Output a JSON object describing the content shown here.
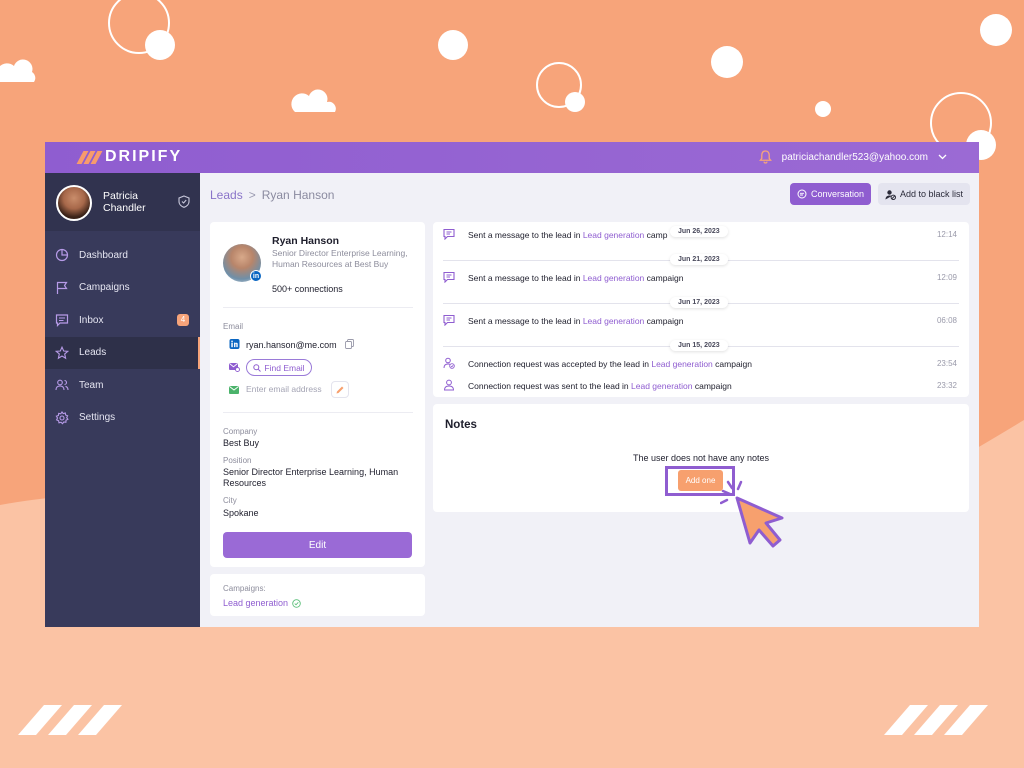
{
  "brand": {
    "name": "DRIPIFY"
  },
  "topbar": {
    "user_email": "patriciachandler523@yahoo.com"
  },
  "user": {
    "name": "Patricia Chandler"
  },
  "nav": [
    {
      "label": "Dashboard",
      "icon": "pie-chart-icon"
    },
    {
      "label": "Campaigns",
      "icon": "flag-icon"
    },
    {
      "label": "Inbox",
      "icon": "message-icon",
      "badge": "4"
    },
    {
      "label": "Leads",
      "icon": "star-icon",
      "active": true
    },
    {
      "label": "Team",
      "icon": "users-icon"
    },
    {
      "label": "Settings",
      "icon": "gear-icon"
    }
  ],
  "breadcrumb": {
    "root": "Leads",
    "separator": ">",
    "current": "Ryan Hanson"
  },
  "actions": {
    "conversation": "Conversation",
    "blacklist": "Add to black list"
  },
  "lead": {
    "name": "Ryan Hanson",
    "headline": "Senior Director Enterprise Learning, Human Resources at Best Buy",
    "connections": "500+ connections",
    "email_label": "Email",
    "email": "ryan.hanson@me.com",
    "find_email": "Find Email",
    "email_placeholder": "Enter email address",
    "company_label": "Company",
    "company": "Best Buy",
    "position_label": "Position",
    "position": "Senior Director Enterprise Learning, Human Resources",
    "city_label": "City",
    "city": "Spokane",
    "edit": "Edit"
  },
  "campaigns": {
    "label": "Campaigns:",
    "name": "Lead generation"
  },
  "activity": [
    {
      "prefix": "Sent a message to the lead in ",
      "link": "Lead generation",
      "suffix": " camp",
      "time": "12:14",
      "icon": "message-icon"
    },
    {
      "prefix": "Sent a message to the lead in ",
      "link": "Lead generation",
      "suffix": " campaign",
      "time": "12:09",
      "icon": "message-icon"
    },
    {
      "prefix": "Sent a message to the lead in ",
      "link": "Lead generation",
      "suffix": " campaign",
      "time": "06:08",
      "icon": "message-icon"
    },
    {
      "prefix": "Connection request was accepted by the lead in ",
      "link": "Lead generation",
      "suffix": " campaign",
      "time": "23:54",
      "icon": "user-check-icon"
    },
    {
      "prefix": "Connection request was sent to the lead in ",
      "link": "Lead generation",
      "suffix": " campaign",
      "time": "23:32",
      "icon": "user-icon"
    }
  ],
  "dates": [
    "Jun 26, 2023",
    "Jun 21, 2023",
    "Jun 17, 2023",
    "Jun 15, 2023"
  ],
  "notes": {
    "title": "Notes",
    "empty": "The user does not have any notes",
    "add": "Add one"
  },
  "colors": {
    "accent": "#8f5dd0",
    "orange": "#f7a47a",
    "sidebar": "#383a5b",
    "background": "#f7a47a"
  }
}
